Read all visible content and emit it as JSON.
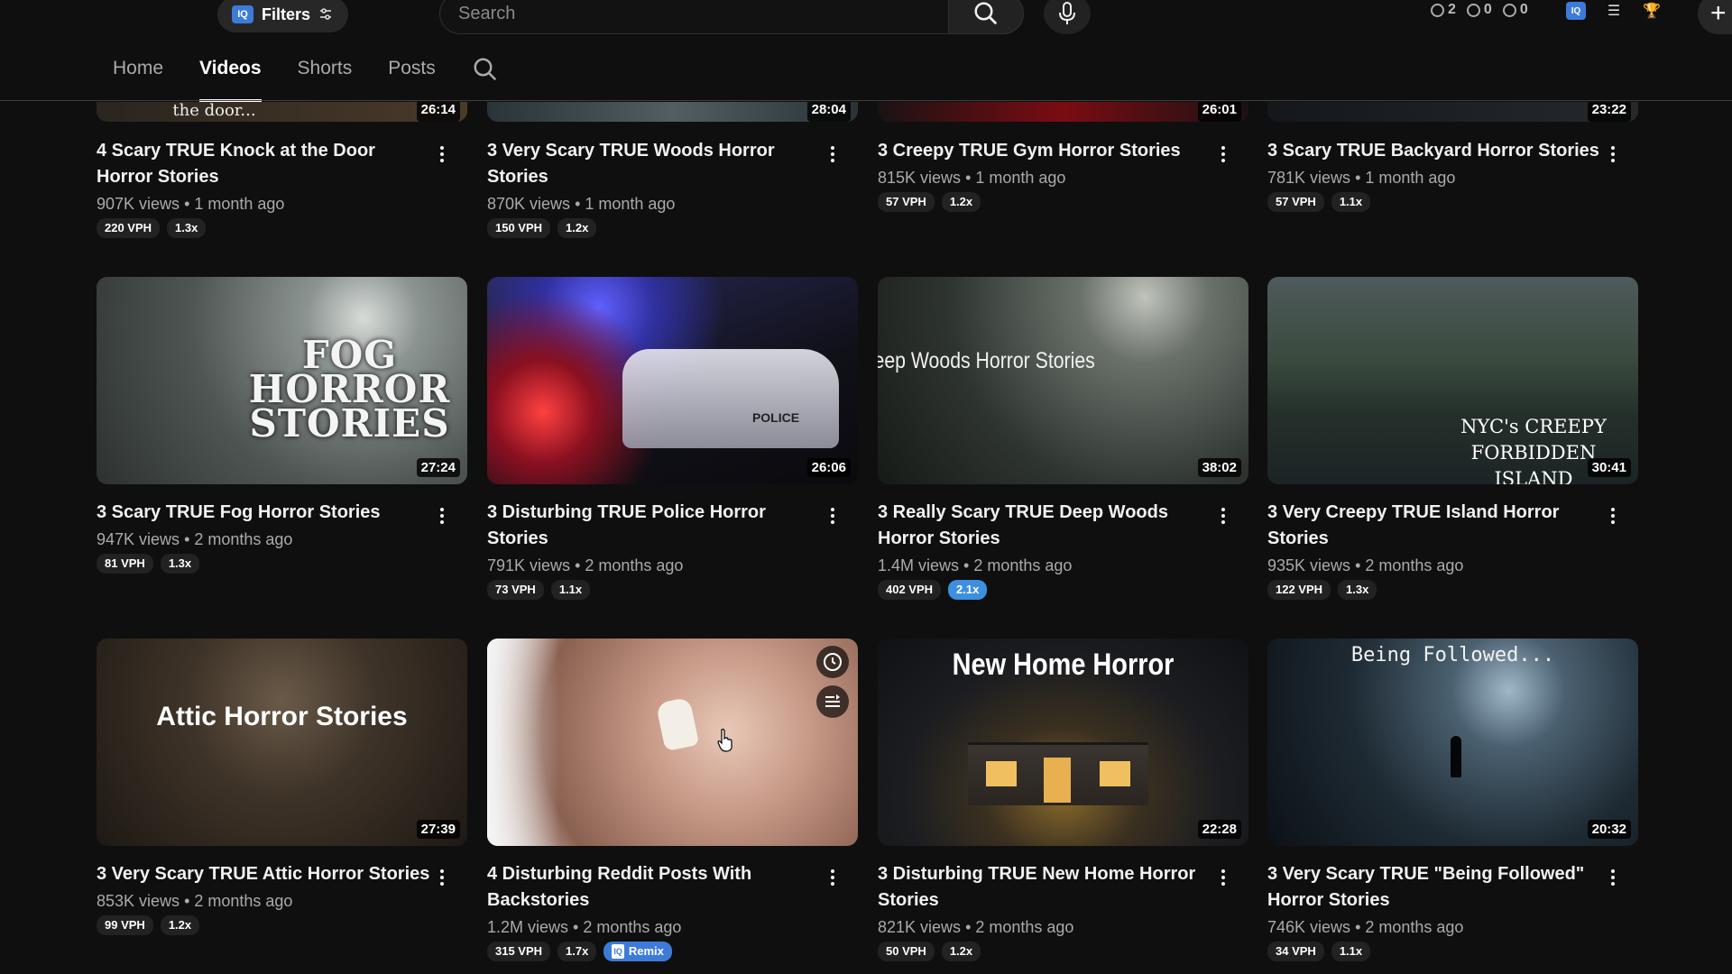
{
  "header": {
    "filters_label": "Filters",
    "search_placeholder": "Search",
    "stats": [
      {
        "icon": "clock-icon",
        "value": "2"
      },
      {
        "icon": "eye-icon",
        "value": "0"
      },
      {
        "icon": "eye-off-icon",
        "value": "0"
      }
    ],
    "colors": {
      "accent": "#3d7bd8",
      "background": "#0f0f0f"
    }
  },
  "tabs": [
    {
      "label": "Home",
      "active": false
    },
    {
      "label": "Videos",
      "active": true
    },
    {
      "label": "Shorts",
      "active": false
    },
    {
      "label": "Posts",
      "active": false
    }
  ],
  "videos": [
    {
      "title": "4 Scary TRUE Knock at the Door Horror Stories",
      "views": "907K views",
      "age": "1 month ago",
      "vph": "220 VPH",
      "mult": "1.3x",
      "duration": "26:14",
      "thumb_text": "the door..."
    },
    {
      "title": "3 Very Scary TRUE Woods Horror Stories",
      "views": "870K views",
      "age": "1 month ago",
      "vph": "150 VPH",
      "mult": "1.2x",
      "duration": "28:04",
      "thumb_text": ""
    },
    {
      "title": "3 Creepy TRUE Gym Horror Stories",
      "views": "815K views",
      "age": "1 month ago",
      "vph": "57 VPH",
      "mult": "1.2x",
      "duration": "26:01",
      "thumb_text": ""
    },
    {
      "title": "3 Scary TRUE Backyard Horror Stories",
      "views": "781K views",
      "age": "1 month ago",
      "vph": "57 VPH",
      "mult": "1.1x",
      "duration": "23:22",
      "thumb_text": ""
    },
    {
      "title": "3 Scary TRUE Fog Horror Stories",
      "views": "947K views",
      "age": "2 months ago",
      "vph": "81 VPH",
      "mult": "1.3x",
      "duration": "27:24",
      "thumb_text": "FOG HORROR STORIES"
    },
    {
      "title": "3 Disturbing TRUE Police Horror Stories",
      "views": "791K views",
      "age": "2 months ago",
      "vph": "73 VPH",
      "mult": "1.1x",
      "duration": "26:06",
      "thumb_text": "POLICE"
    },
    {
      "title": "3 Really Scary TRUE Deep Woods Horror Stories",
      "views": "1.4M views",
      "age": "2 months ago",
      "vph": "402 VPH",
      "mult": "2.1x",
      "mult_highlight": true,
      "duration": "38:02",
      "thumb_text": "Deep Woods Horror Stories"
    },
    {
      "title": "3 Very Creepy TRUE Island Horror Stories",
      "views": "935K views",
      "age": "2 months ago",
      "vph": "122 VPH",
      "mult": "1.3x",
      "duration": "30:41",
      "thumb_text": "NYC's CREEPY FORBIDDEN ISLAND"
    },
    {
      "title": "3 Very Scary TRUE Attic Horror Stories",
      "views": "853K views",
      "age": "2 months ago",
      "vph": "99 VPH",
      "mult": "1.2x",
      "duration": "27:39",
      "thumb_text": "Attic Horror Stories"
    },
    {
      "title": "4 Disturbing Reddit Posts With Backstories",
      "views": "1.2M views",
      "age": "2 months ago",
      "vph": "315 VPH",
      "mult": "1.7x",
      "remix": "Remix",
      "duration": "",
      "thumb_text": ""
    },
    {
      "title": "3 Disturbing TRUE New Home Horror Stories",
      "views": "821K views",
      "age": "2 months ago",
      "vph": "50 VPH",
      "mult": "1.2x",
      "duration": "22:28",
      "thumb_text": "New Home Horror"
    },
    {
      "title": "3 Very Scary TRUE \"Being Followed\" Horror Stories",
      "views": "746K views",
      "age": "2 months ago",
      "vph": "34 VPH",
      "mult": "1.1x",
      "duration": "20:32",
      "thumb_text": "Being Followed..."
    }
  ]
}
